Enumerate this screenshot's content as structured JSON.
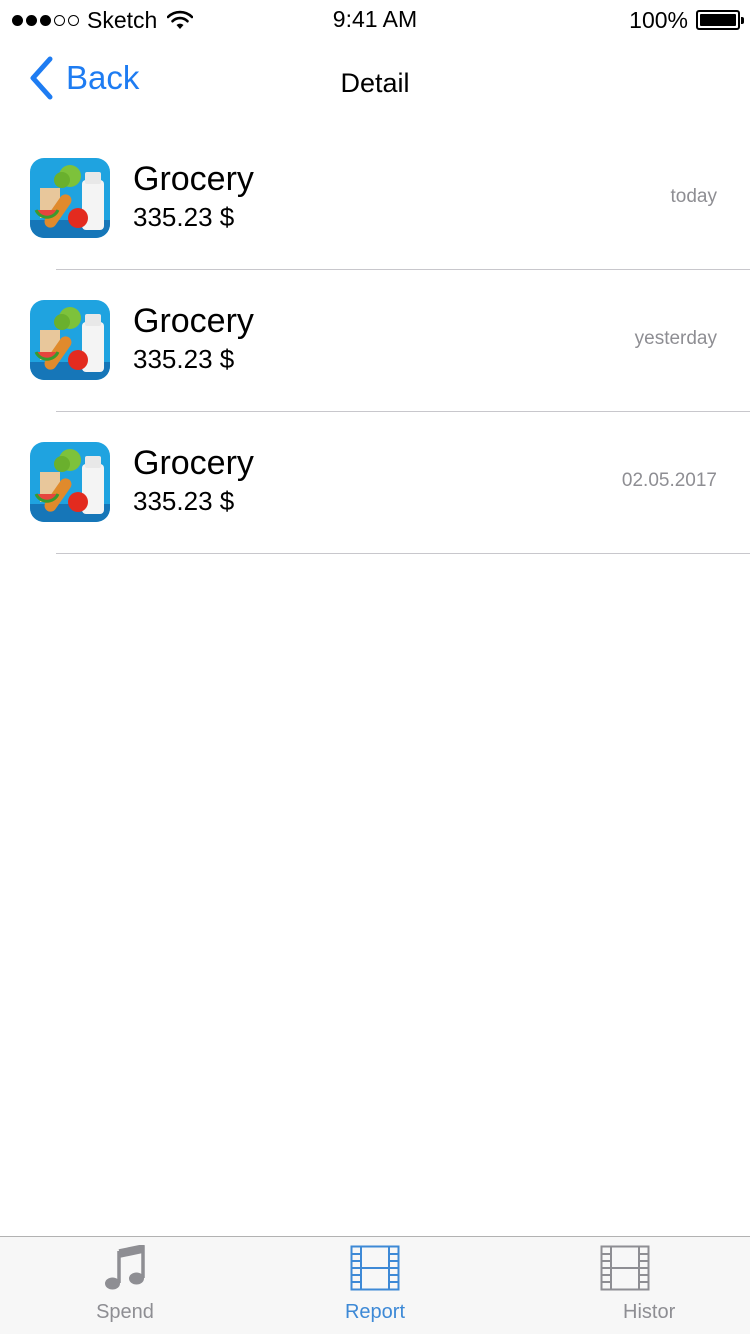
{
  "status_bar": {
    "carrier": "Sketch",
    "time": "9:41 AM",
    "battery": "100%"
  },
  "nav": {
    "back_label": "Back",
    "title": "Detail"
  },
  "transactions": [
    {
      "title": "Grocery",
      "amount": "335.23 $",
      "date": "today"
    },
    {
      "title": "Grocery",
      "amount": "335.23 $",
      "date": "yesterday"
    },
    {
      "title": "Grocery",
      "amount": "335.23 $",
      "date": "02.05.2017"
    }
  ],
  "tab_bar": {
    "tabs": [
      {
        "label": "Spend",
        "icon": "music-note-icon",
        "active": false
      },
      {
        "label": "Report",
        "icon": "film-icon",
        "active": true
      },
      {
        "label": "Histor",
        "icon": "film-icon",
        "active": false
      }
    ]
  },
  "colors": {
    "accent": "#1e7cf2",
    "tab_active": "#3d89d6",
    "muted": "#8e8e93",
    "separator": "#c8c7cc"
  }
}
